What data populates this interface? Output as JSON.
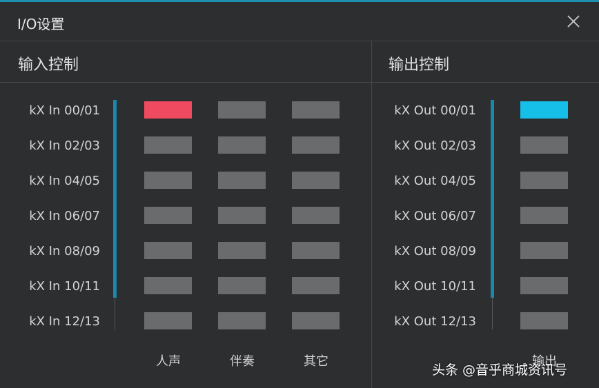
{
  "dialog": {
    "title": "I/O设置"
  },
  "colors": {
    "accent": "#1a87ad",
    "input_active": "#ef4a5f",
    "output_active": "#16bfe8",
    "cell_inactive": "#6a6b6d"
  },
  "icons": {
    "close": "close-icon"
  },
  "input_control": {
    "title": "输入控制",
    "rows": [
      "kX In 00/01",
      "kX In 02/03",
      "kX In 04/05",
      "kX In 06/07",
      "kX In 08/09",
      "kX In 10/11",
      "kX In 12/13"
    ],
    "columns": [
      "人声",
      "伴奏",
      "其它"
    ],
    "selected": {
      "row": 0,
      "column": 0
    }
  },
  "output_control": {
    "title": "输出控制",
    "rows": [
      "kX Out 00/01",
      "kX Out 02/03",
      "kX Out 04/05",
      "kX Out 06/07",
      "kX Out 08/09",
      "kX Out 10/11",
      "kX Out 12/13"
    ],
    "columns": [
      "输出"
    ],
    "selected": {
      "row": 0,
      "column": 0
    }
  },
  "watermark": {
    "text": "头条 @音乎商城资讯号"
  }
}
